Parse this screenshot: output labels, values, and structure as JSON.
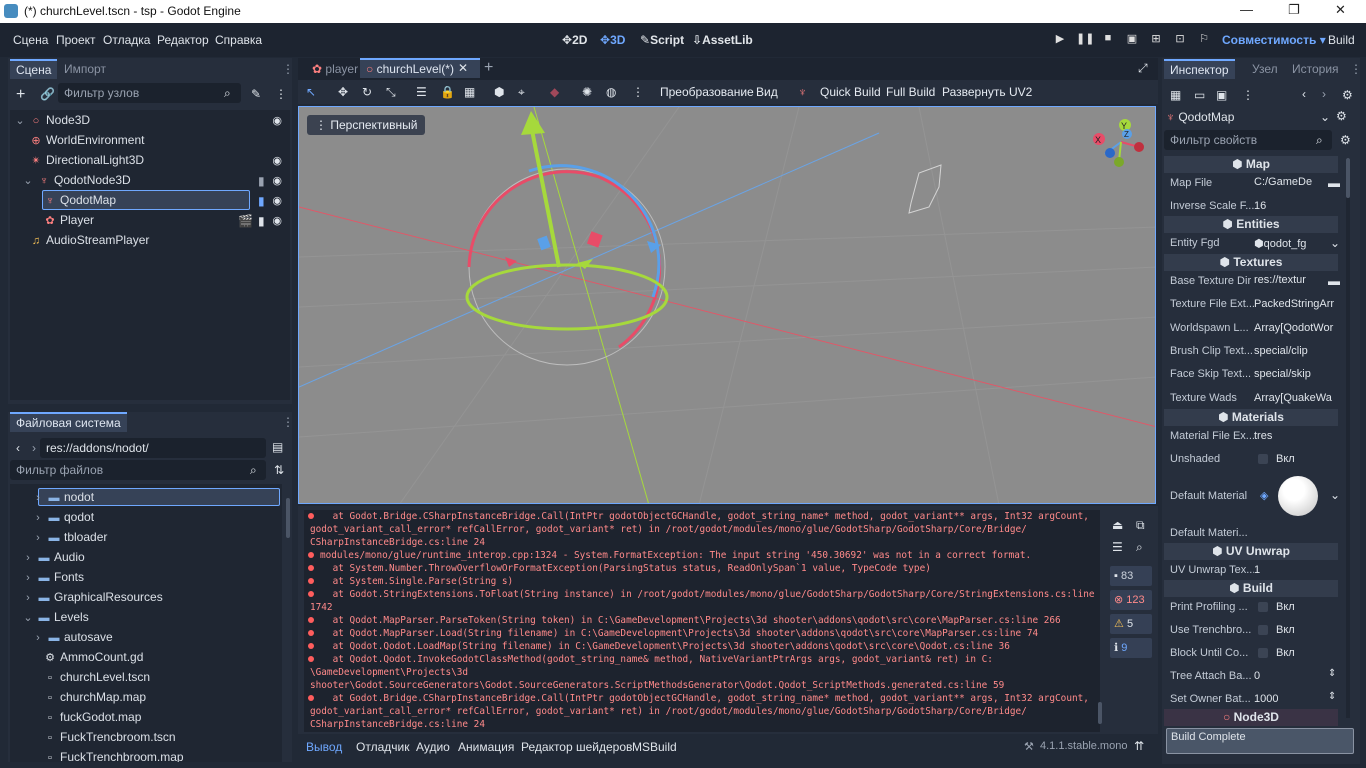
{
  "window": {
    "title": "(*) churchLevel.tscn - tsp - Godot Engine",
    "controls": [
      "—",
      "❐",
      "✕"
    ]
  },
  "menu": [
    "Сцена",
    "Проект",
    "Отладка",
    "Редактор",
    "Справка"
  ],
  "modes": [
    "2D",
    "3D",
    "Script",
    "AssetLib"
  ],
  "renderer": "Совместимость",
  "build_label": "Build",
  "scene_tabs": [
    "Сцена",
    "Импорт"
  ],
  "node_filter_placeholder": "Фильтр узлов",
  "scene_tree": [
    "Node3D",
    "WorldEnvironment",
    "DirectionalLight3D",
    "QodotNode3D",
    "QodotMap",
    "Player",
    "AudioStreamPlayer"
  ],
  "fs_tab": "Файловая система",
  "fs_path": "res://addons/nodot/",
  "fs_filter_placeholder": "Фильтр файлов",
  "fs_items": [
    "nodot",
    "qodot",
    "tbloader",
    "Audio",
    "Fonts",
    "GraphicalResources",
    "Levels",
    "autosave",
    "AmmoCount.gd",
    "churchLevel.tscn",
    "churchMap.map",
    "fuckGodot.map",
    "FuckTrencbroom.tscn",
    "FuckTrenchbroom.map"
  ],
  "editor_tabs": [
    "player",
    "churchLevel(*)"
  ],
  "viewport_toolbar": {
    "transform": "Преобразование",
    "view": "Вид",
    "quick_build": "Quick Build",
    "full_build": "Full Build",
    "unwrap": "Развернуть UV2"
  },
  "viewport_label": "Перспективный",
  "log_lines": [
    "    at Godot.Bridge.CSharpInstanceBridge.Call(IntPtr godotObjectGCHandle, godot_string_name* method, godot_variant** args, Int32 argCount,",
    "godot_variant_call_error* refCallError, godot_variant* ret) in /root/godot/modules/mono/glue/GodotSharp/GodotSharp/Core/Bridge/",
    "CSharpInstanceBridge.cs:line 24",
    "modules/mono/glue/runtime_interop.cpp:1324 - System.FormatException: The input string '450.30692' was not in a correct format.",
    "    at System.Number.ThrowOverflowOrFormatException(ParsingStatus status, ReadOnlySpan`1 value, TypeCode type)",
    "    at System.Single.Parse(String s)",
    "    at Godot.StringExtensions.ToFloat(String instance) in /root/godot/modules/mono/glue/GodotSharp/GodotSharp/Core/StringExtensions.cs:line",
    "1742",
    "    at Qodot.MapParser.ParseToken(String token) in C:\\GameDevelopment\\Projects\\3d shooter\\addons\\qodot\\src\\core\\MapParser.cs:line 266",
    "    at Qodot.MapParser.Load(String filename) in C:\\GameDevelopment\\Projects\\3d shooter\\addons\\qodot\\src\\core\\MapParser.cs:line 74",
    "    at Qodot.Qodot.LoadMap(String filename) in C:\\GameDevelopment\\Projects\\3d shooter\\addons\\qodot\\src\\core\\Qodot.cs:line 36",
    "    at Qodot.Qodot.InvokeGodotClassMethod(godot_string_name& method, NativeVariantPtrArgs args, godot_variant& ret) in C:",
    "\\GameDevelopment\\Projects\\3d",
    "shooter\\Godot.SourceGenerators\\Godot.SourceGenerators.ScriptMethodsGenerator\\Qodot.Qodot_ScriptMethods.generated.cs:line 59",
    "    at Godot.Bridge.CSharpInstanceBridge.Call(IntPtr godotObjectGCHandle, godot_string_name* method, godot_variant** args, Int32 argCount,",
    "godot_variant_call_error* refCallError, godot_variant* ret) in /root/godot/modules/mono/glue/GodotSharp/GodotSharp/Core/Bridge/",
    "CSharpInstanceBridge.cs:line 24"
  ],
  "log_counts": {
    "messages": "83",
    "errors": "123",
    "warnings": "5",
    "info": "9"
  },
  "bottom_tabs": [
    "Вывод",
    "Отладчик",
    "Аудио",
    "Анимация",
    "Редактор шейдеров",
    "MSBuild"
  ],
  "version": "4.1.1.stable.mono",
  "inspector_tabs": [
    "Инспектор",
    "Узел",
    "История"
  ],
  "inspector_node": "QodotMap",
  "prop_filter": "Фильтр свойств",
  "sections": [
    "Map",
    "Entities",
    "Textures",
    "Materials",
    "UV Unwrap",
    "Build",
    "Node3D"
  ],
  "props": [
    {
      "label": "Map File",
      "value": "C:/GameDe"
    },
    {
      "label": "Inverse Scale F...",
      "value": "16"
    },
    {
      "label": "Entity Fgd",
      "value": "qodot_fg"
    },
    {
      "label": "Base Texture Dir",
      "value": "res://textur"
    },
    {
      "label": "Texture File Ext...",
      "value": "PackedStringArr"
    },
    {
      "label": "Worldspawn L...",
      "value": "Array[QodotWor"
    },
    {
      "label": "Brush Clip Text...",
      "value": "special/clip"
    },
    {
      "label": "Face Skip Text...",
      "value": "special/skip"
    },
    {
      "label": "Texture Wads",
      "value": "Array[QuakeWa"
    },
    {
      "label": "Material File Ex...",
      "value": "tres"
    },
    {
      "label": "Unshaded",
      "value": "Вкл"
    },
    {
      "label": "Default Material",
      "value": ""
    },
    {
      "label": "Default Materi...",
      "value": ""
    },
    {
      "label": "UV Unwrap Tex...",
      "value": "1"
    },
    {
      "label": "Print Profiling ...",
      "value": "Вкл"
    },
    {
      "label": "Use Trenchbro...",
      "value": "Вкл"
    },
    {
      "label": "Block Until Co...",
      "value": "Вкл"
    },
    {
      "label": "Tree Attach Ba...",
      "value": "0"
    },
    {
      "label": "Set Owner Bat...",
      "value": "1000"
    }
  ],
  "status": "Build Complete",
  "colors": {
    "accent": "#6fa8ff",
    "error": "#ff8a8a"
  }
}
